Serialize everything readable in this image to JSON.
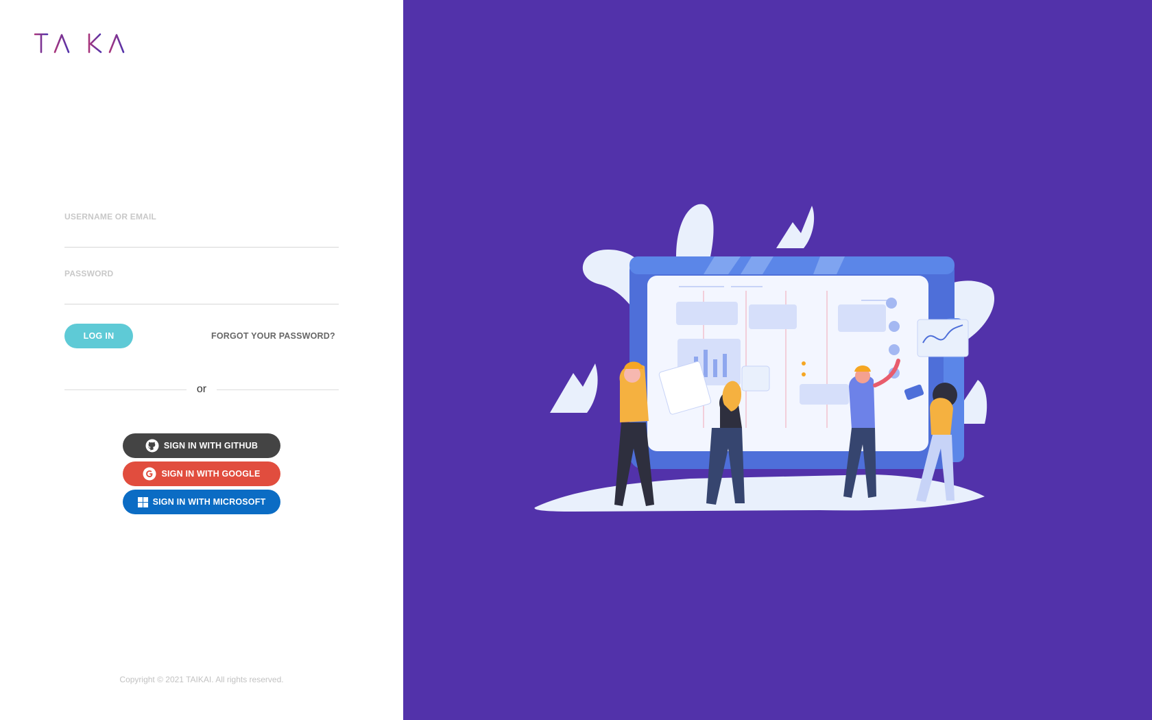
{
  "brand": {
    "name": "TAIKAI",
    "colors": {
      "logo_start": "#A8357C",
      "logo_end": "#5232AA"
    }
  },
  "login_form": {
    "username_label": "USERNAME OR EMAIL",
    "username_value": "",
    "password_label": "PASSWORD",
    "password_value": "",
    "login_button": "LOG IN",
    "forgot_link": "FORGOT YOUR PASSWORD?",
    "divider_text": "or"
  },
  "social": {
    "github": {
      "label": "SIGN IN WITH GITHUB",
      "icon": "github-icon",
      "color": "#444444"
    },
    "google": {
      "label": "SIGN IN WITH GOOGLE",
      "icon": "google-icon",
      "color": "#E14D3E"
    },
    "microsoft": {
      "label": "SIGN IN WITH MICROSOFT",
      "icon": "microsoft-icon",
      "color": "#0B6CC4"
    }
  },
  "footer": {
    "copyright": "Copyright © 2021 TAIKAI. All rights reserved."
  },
  "theme": {
    "accent": "#5ECAD6",
    "panel_background": "#5232AA"
  }
}
